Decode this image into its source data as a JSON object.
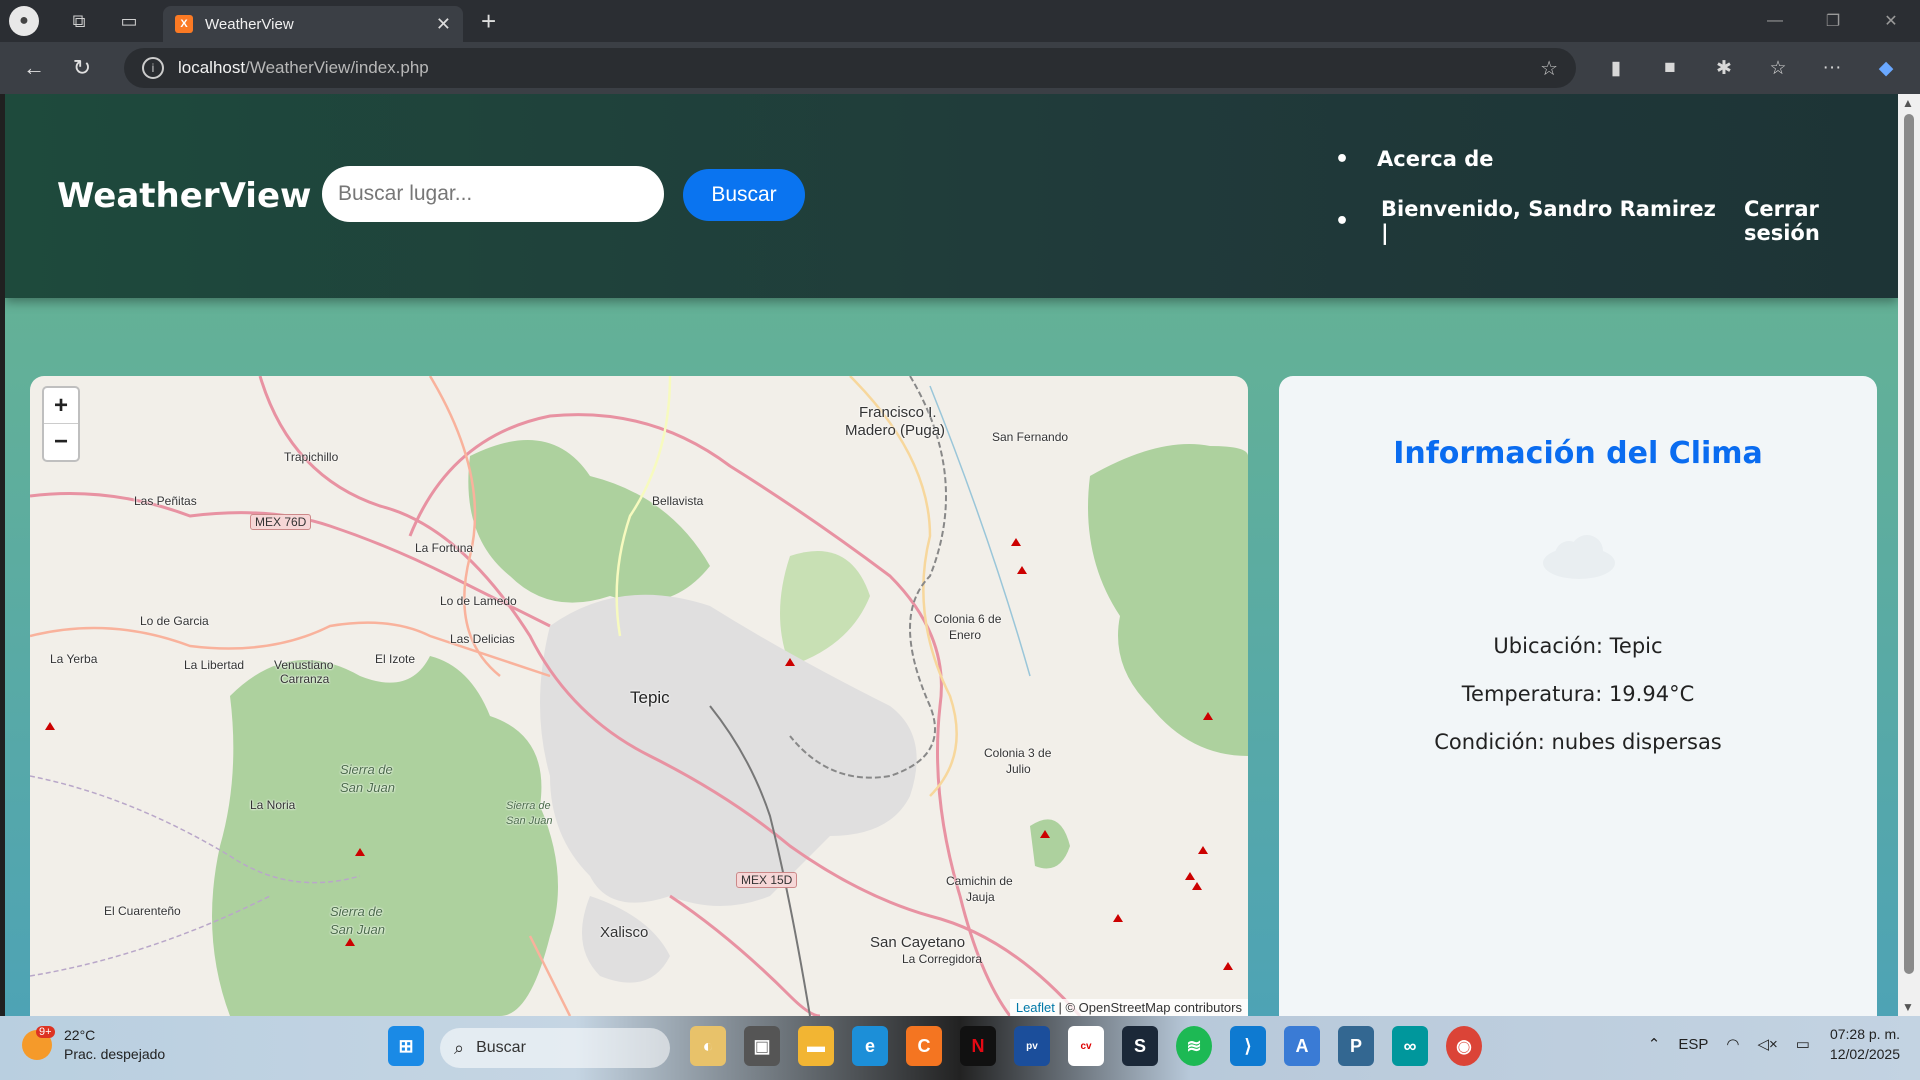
{
  "browser": {
    "tab_title": "WeatherView",
    "tab_close": "✕",
    "new_tab": "+",
    "url_host": "localhost",
    "url_path": "/WeatherView/index.php"
  },
  "site": {
    "logo": "WeatherView",
    "search_placeholder": "Buscar lugar...",
    "search_button": "Buscar",
    "nav_about": "Acerca de",
    "nav_welcome": "Bienvenido, Sandro Ramirez |",
    "nav_logout": "Cerrar sesión"
  },
  "map": {
    "zoom_in": "+",
    "zoom_out": "−",
    "attribution_leaflet": "Leaflet",
    "attribution_rest": " | © OpenStreetMap contributors",
    "labels": {
      "francisco": "Francisco I.",
      "madero": "Madero (Puga)",
      "san_fernando": "San Fernando",
      "trapichillo": "Trapichillo",
      "las_penitas": "Las Peñitas",
      "bellavista": "Bellavista",
      "la_fortuna": "La Fortuna",
      "lo_de_lamedo": "Lo de Lamedo",
      "lo_de_garcia": "Lo de Garcia",
      "las_delicias": "Las Delicias",
      "la_yerba": "La Yerba",
      "la_libertad": "La Libertad",
      "venustiano": "Venustiano",
      "carranza": "Carranza",
      "el_izote": "El Izote",
      "tepic": "Tepic",
      "colonia6": "Colonia 6 de",
      "enero": "Enero",
      "colonia3": "Colonia 3 de",
      "julio": "Julio",
      "sierra1a": "Sierra de",
      "sierra1b": "San Juan",
      "sierra2a": "Sierra de",
      "sierra2b": "San Juan",
      "sierra3a": "Sierra de",
      "sierra3b": "San Juan",
      "la_noria": "La Noria",
      "el_cuarenteno": "El Cuarenteño",
      "xalisco": "Xalisco",
      "camichin": "Camichin de",
      "jauja": "Jauja",
      "san_cayetano": "San Cayetano",
      "la_corregidora": "La Corregidora",
      "mex76d": "MEX 76D",
      "mex15d": "MEX 15D",
      "tepic_road": "Tepic"
    }
  },
  "weather": {
    "heading": "Información del Clima",
    "location": "Ubicación: Tepic",
    "temperature": "Temperatura: 19.94°C",
    "condition": "Condición: nubes dispersas"
  },
  "taskbar": {
    "temp": "22°C",
    "weather_desc": "Prac. despejado",
    "badge": "9+",
    "search": "Buscar",
    "lang": "ESP",
    "time": "07:28 p. m.",
    "date": "12/02/2025"
  }
}
